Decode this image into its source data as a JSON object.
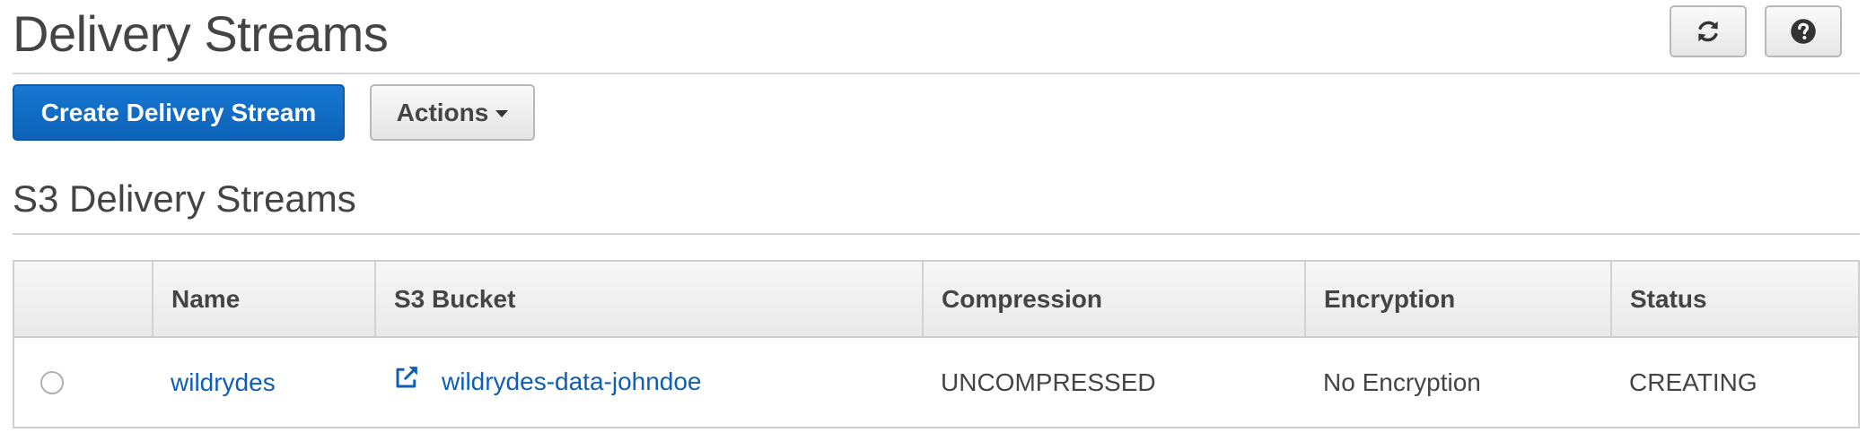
{
  "header": {
    "title": "Delivery Streams",
    "refresh_icon": "refresh-icon",
    "help_icon": "question-circle-icon"
  },
  "toolbar": {
    "create_label": "Create Delivery Stream",
    "actions_label": "Actions"
  },
  "section": {
    "title": "S3 Delivery Streams"
  },
  "table": {
    "columns": [
      "Name",
      "S3 Bucket",
      "Compression",
      "Encryption",
      "Status"
    ],
    "rows": [
      {
        "name": "wildrydes",
        "bucket": "wildrydes-data-johndoe",
        "compression": "UNCOMPRESSED",
        "encryption": "No Encryption",
        "status": "CREATING"
      }
    ]
  },
  "colors": {
    "primary": "#0d62b8",
    "link": "#0f5fb5",
    "text": "#444444"
  }
}
